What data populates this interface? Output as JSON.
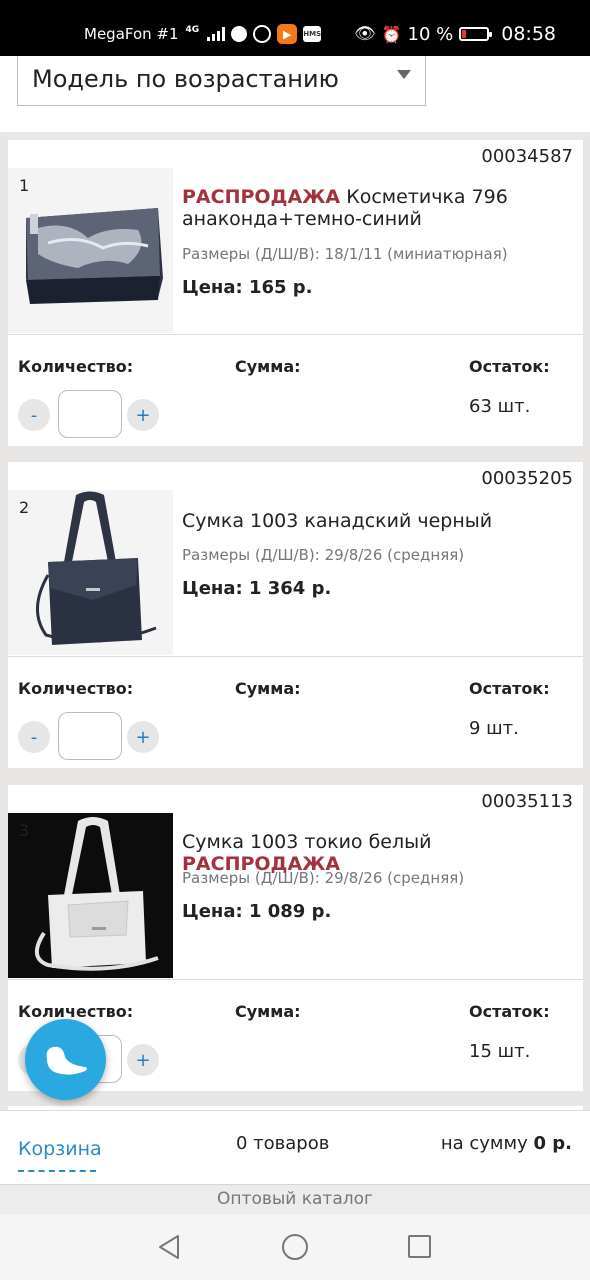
{
  "status_bar": {
    "carrier": "MegaFon #1",
    "network": "4G",
    "app_icon_label": "HMS",
    "battery_percent": "10 %",
    "time": "08:58"
  },
  "sort": {
    "selected": "Модель по возрастанию"
  },
  "products": [
    {
      "index": "1",
      "code": "00034587",
      "sale_badge": "РАСПРОДАЖА",
      "title": "Косметичка 796 анаконда+темно-синий",
      "sizes": "Размеры (Д/Ш/В): 18/1/11 (миниатюрная)",
      "price": "Цена: 165 р.",
      "qty_label": "Количество:",
      "sum_label": "Сумма:",
      "stock_label": "Остаток:",
      "stock": "63 шт.",
      "minus": "-",
      "plus": "+"
    },
    {
      "index": "2",
      "code": "00035205",
      "sale_badge": "",
      "title": "Сумка 1003 канадский черный",
      "sizes": "Размеры (Д/Ш/В): 29/8/26 (средняя)",
      "price": "Цена: 1 364 р.",
      "qty_label": "Количество:",
      "sum_label": "Сумма:",
      "stock_label": "Остаток:",
      "stock": "9 шт.",
      "minus": "-",
      "plus": "+"
    },
    {
      "index": "3",
      "code": "00035113",
      "sale_badge": "РАСПРОДАЖА",
      "title": "Сумка 1003 токио белый",
      "sizes": "Размеры (Д/Ш/В): 29/8/26 (средняя)",
      "price": "Цена: 1 089 р.",
      "qty_label": "Количество:",
      "sum_label": "Сумма:",
      "stock_label": "Остаток:",
      "stock": "15 шт.",
      "minus": "-",
      "plus": "+"
    }
  ],
  "cart": {
    "link": "Корзина",
    "count": "0 товаров",
    "sum_prefix": "на сумму",
    "sum_value": "0 р."
  },
  "catalog": {
    "label": "Оптовый каталог"
  },
  "colors": {
    "sale_red": "#a3323c",
    "link_blue": "#2a8bc7",
    "fab_blue": "#2aa9e0"
  }
}
